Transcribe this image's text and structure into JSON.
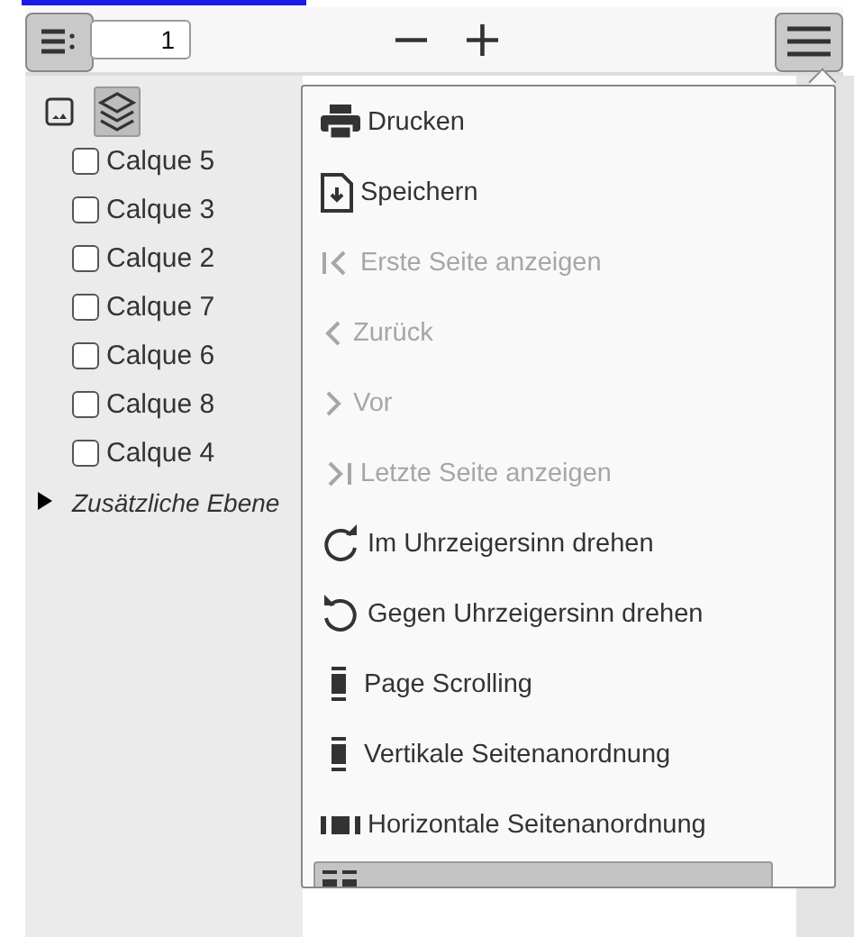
{
  "toolbar": {
    "page_number": "1",
    "zoom_out": "−",
    "zoom_in": "+"
  },
  "sidebar": {
    "views": [
      {
        "kind": "thumbnails",
        "selected": false
      },
      {
        "kind": "layers",
        "selected": true
      }
    ],
    "layers": [
      {
        "label": "Calque 5",
        "checked": false
      },
      {
        "label": "Calque 3",
        "checked": false
      },
      {
        "label": "Calque 2",
        "checked": false
      },
      {
        "label": "Calque 7",
        "checked": false
      },
      {
        "label": "Calque 6",
        "checked": false
      },
      {
        "label": "Calque 8",
        "checked": false
      },
      {
        "label": "Calque 4",
        "checked": false
      }
    ],
    "additional": {
      "label": "Zusätzliche Ebene",
      "expanded": false
    }
  },
  "menu": {
    "items": [
      {
        "kind": "print",
        "label": "Drucken",
        "disabled": false,
        "selected": false
      },
      {
        "kind": "save",
        "label": "Speichern",
        "disabled": false,
        "selected": false
      },
      {
        "kind": "first",
        "label": "Erste Seite anzeigen",
        "disabled": true,
        "selected": false
      },
      {
        "kind": "prev",
        "label": "Zurück",
        "disabled": true,
        "selected": false
      },
      {
        "kind": "next",
        "label": "Vor",
        "disabled": true,
        "selected": false
      },
      {
        "kind": "last",
        "label": "Letzte Seite anzeigen",
        "disabled": true,
        "selected": false
      },
      {
        "kind": "cw",
        "label": "Im Uhrzeigersinn drehen",
        "disabled": false,
        "selected": false
      },
      {
        "kind": "ccw",
        "label": "Gegen Uhrzeigersinn drehen",
        "disabled": false,
        "selected": false
      },
      {
        "kind": "page",
        "label": "Page Scrolling",
        "disabled": false,
        "selected": false
      },
      {
        "kind": "vertical",
        "label": "Vertikale Seitenanordnung",
        "disabled": false,
        "selected": false
      },
      {
        "kind": "horizontal",
        "label": "Horizontale Seitenanordnung",
        "disabled": false,
        "selected": false
      },
      {
        "kind": "combined",
        "disabled": false,
        "selected": true
      }
    ]
  }
}
